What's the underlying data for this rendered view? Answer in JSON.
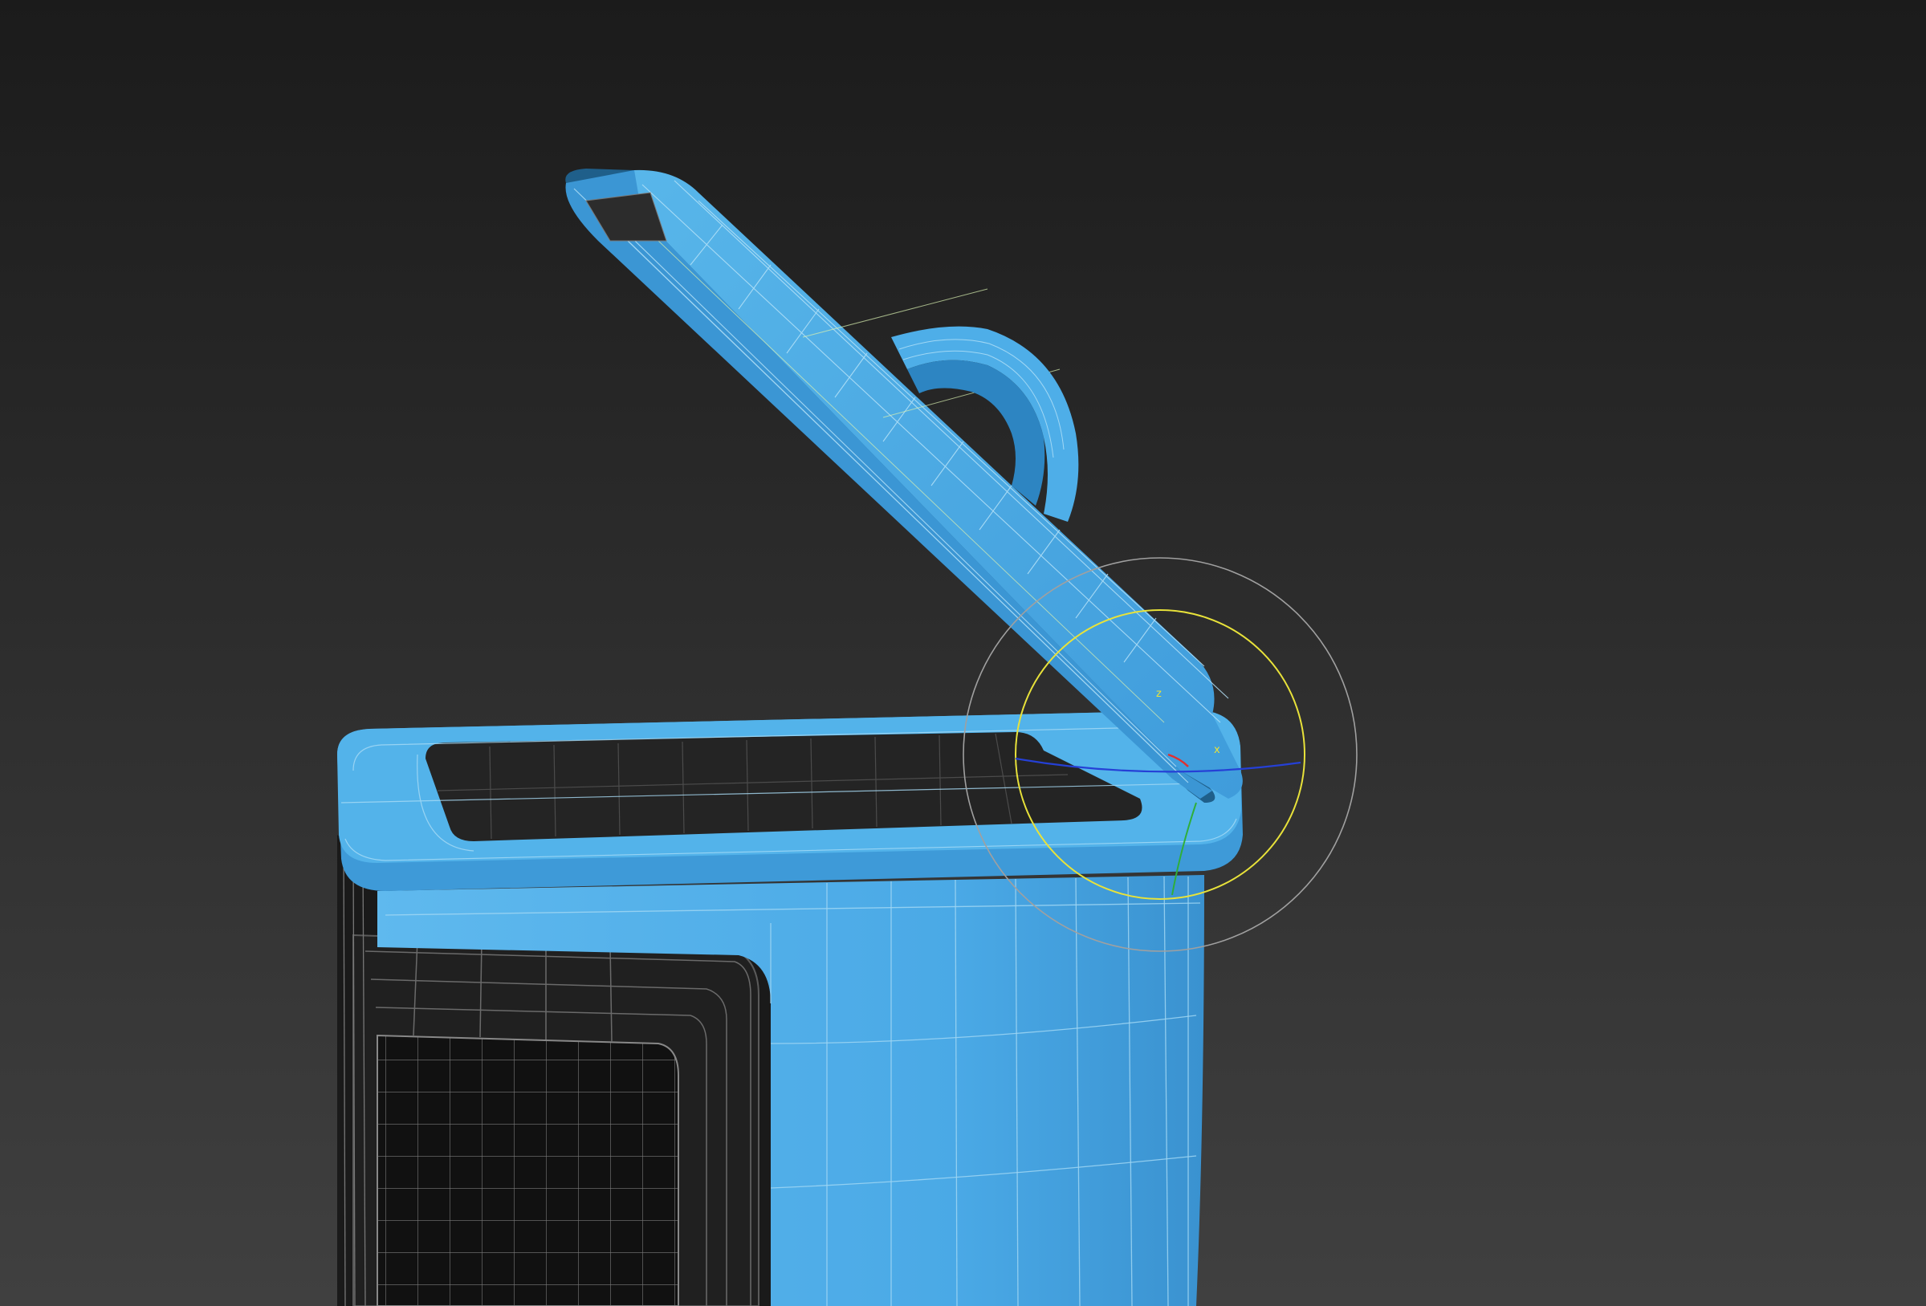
{
  "viewport": {
    "background_top": "#1b1b1b",
    "background_bottom": "#404040",
    "view": "perspective"
  },
  "model": {
    "object": "trash bin",
    "lid_state": "open",
    "colors": {
      "body": "#4aa9e6",
      "body_light": "#6cc6f3",
      "body_shade": "#2e86c4",
      "inner": "#1e1e1e",
      "pedal_dark": "#141414",
      "wire_body": "#bfe4f7",
      "wire_dark": "#6a6a6a",
      "wire_selected": "#d8f0b0"
    }
  },
  "gizmo": {
    "type": "rotate",
    "colors": {
      "x": "#e03030",
      "y": "#2fae3a",
      "z": "#2540d6",
      "screen": "#e8e23a",
      "outer": "#a0a0a0"
    },
    "labels": {
      "z_axis": "z",
      "x_axis": "x"
    }
  }
}
